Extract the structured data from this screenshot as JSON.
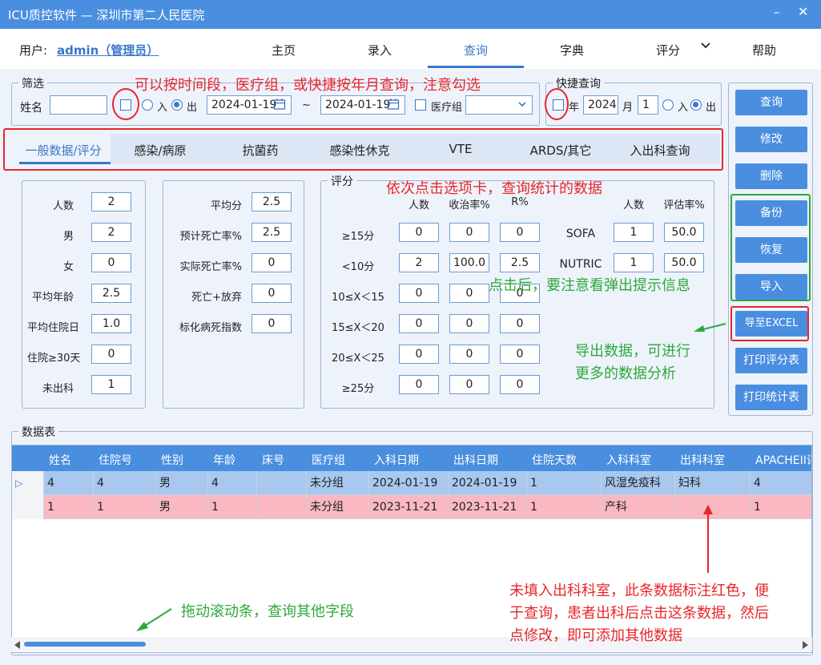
{
  "window": {
    "title": "ICU质控软件 — 深圳市第二人民医院",
    "minimize": "–",
    "close": "✕"
  },
  "menubar": {
    "user_label": "用户:",
    "user_name": "admin（管理员）",
    "items": [
      "主页",
      "录入",
      "查询",
      "字典",
      "评分",
      "帮助"
    ]
  },
  "filter": {
    "legend": "筛选",
    "name_label": "姓名",
    "name_value": "",
    "radio_in": "入",
    "radio_out": "出",
    "date_from": "2024-01-19",
    "tilde": "~",
    "date_to": "2024-01-19",
    "group_label": "医疗组",
    "group_value": ""
  },
  "quick": {
    "legend": "快捷查询",
    "year_label": "年",
    "year_value": "2024",
    "month_label": "月",
    "month_value": "1",
    "radio_in": "入",
    "radio_out": "出"
  },
  "tabs": [
    "一般数据/评分",
    "感染/病原",
    "抗菌药",
    "感染性休克",
    "VTE",
    "ARDS/其它",
    "入出科查询"
  ],
  "buttons": [
    "查询",
    "修改",
    "删除",
    "备份",
    "恢复",
    "导入",
    "导至EXCEL",
    "打印评分表",
    "打印统计表"
  ],
  "panel1": {
    "rows": [
      {
        "label": "人数",
        "value": "2"
      },
      {
        "label": "男",
        "value": "2"
      },
      {
        "label": "女",
        "value": "0"
      },
      {
        "label": "平均年龄",
        "value": "2.5"
      },
      {
        "label": "平均住院日",
        "value": "1.0"
      },
      {
        "label": "住院≥30天",
        "value": "0"
      },
      {
        "label": "未出科",
        "value": "1"
      }
    ]
  },
  "panel2": {
    "rows": [
      {
        "label": "平均分",
        "value": "2.5"
      },
      {
        "label": "预计死亡率%",
        "value": "2.5"
      },
      {
        "label": "实际死亡率%",
        "value": "0"
      },
      {
        "label": "死亡+放弃",
        "value": "0"
      },
      {
        "label": "标化病死指数",
        "value": "0"
      }
    ]
  },
  "score": {
    "legend": "评分",
    "headers": [
      "人数",
      "收治率%",
      "R%"
    ],
    "rows": [
      {
        "label": "≥15分",
        "values": [
          "0",
          "0",
          "0"
        ]
      },
      {
        "label": "<10分",
        "values": [
          "2",
          "100.0",
          "2.5"
        ]
      },
      {
        "label": "10≤X＜15",
        "values": [
          "0",
          "0",
          "0"
        ]
      },
      {
        "label": "15≤X＜20",
        "values": [
          "0",
          "0",
          "0"
        ]
      },
      {
        "label": "20≤X＜25",
        "values": [
          "0",
          "0",
          "0"
        ]
      },
      {
        "label": "≥25分",
        "values": [
          "0",
          "0",
          "0"
        ]
      }
    ],
    "right_headers": [
      "人数",
      "评估率%"
    ],
    "right_rows": [
      {
        "label": "SOFA",
        "values": [
          "1",
          "50.0"
        ]
      },
      {
        "label": "NUTRIC",
        "values": [
          "1",
          "50.0"
        ]
      }
    ]
  },
  "table": {
    "legend": "数据表",
    "columns": [
      "姓名",
      "住院号",
      "性别",
      "年龄",
      "床号",
      "医疗组",
      "入科日期",
      "出科日期",
      "住院天数",
      "入科科室",
      "出科科室",
      "APACHEII评"
    ],
    "rows": [
      [
        "4",
        "4",
        "男",
        "4",
        "",
        "未分组",
        "2024-01-19",
        "2024-01-19",
        "1",
        "风湿免疫科",
        "妇科",
        "4"
      ],
      [
        "1",
        "1",
        "男",
        "1",
        "",
        "未分组",
        "2023-11-21",
        "2023-11-21",
        "1",
        "产科",
        "",
        "1"
      ]
    ],
    "row_pointer": "▷"
  },
  "annotations": {
    "top": "可以按时间段，医疗组，或快捷按年月查询，注意勾选",
    "tabs": "依次点击选项卡，查询统计的数据",
    "popup": "点击后，要注意看弹出提示信息",
    "export1": "导出数据，可进行",
    "export2": "更多的数据分析",
    "scroll": "拖动滚动条，查询其他字段",
    "red1": "未填入出科科室，此条数据标注红色，便",
    "red2": "于查询，患者出科后点击这条数据，然后",
    "red3": "点修改，即可添加其他数据"
  },
  "colors": {
    "accent": "#4a8ee0",
    "red": "#e8262a",
    "green": "#2ca93a",
    "row_selected": "#a8c8f0",
    "row_missing": "#f9b8c2"
  }
}
